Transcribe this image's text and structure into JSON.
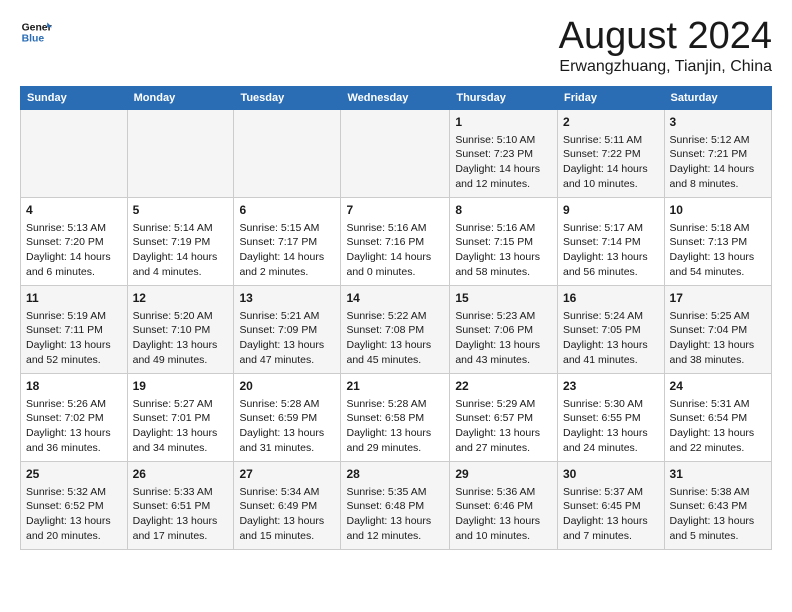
{
  "logo": {
    "line1": "General",
    "line2": "Blue"
  },
  "title": "August 2024",
  "location": "Erwangzhuang, Tianjin, China",
  "headers": [
    "Sunday",
    "Monday",
    "Tuesday",
    "Wednesday",
    "Thursday",
    "Friday",
    "Saturday"
  ],
  "rows": [
    [
      {
        "day": "",
        "sunrise": "",
        "sunset": "",
        "daylight": ""
      },
      {
        "day": "",
        "sunrise": "",
        "sunset": "",
        "daylight": ""
      },
      {
        "day": "",
        "sunrise": "",
        "sunset": "",
        "daylight": ""
      },
      {
        "day": "",
        "sunrise": "",
        "sunset": "",
        "daylight": ""
      },
      {
        "day": "1",
        "sunrise": "Sunrise: 5:10 AM",
        "sunset": "Sunset: 7:23 PM",
        "daylight": "Daylight: 14 hours and 12 minutes."
      },
      {
        "day": "2",
        "sunrise": "Sunrise: 5:11 AM",
        "sunset": "Sunset: 7:22 PM",
        "daylight": "Daylight: 14 hours and 10 minutes."
      },
      {
        "day": "3",
        "sunrise": "Sunrise: 5:12 AM",
        "sunset": "Sunset: 7:21 PM",
        "daylight": "Daylight: 14 hours and 8 minutes."
      }
    ],
    [
      {
        "day": "4",
        "sunrise": "Sunrise: 5:13 AM",
        "sunset": "Sunset: 7:20 PM",
        "daylight": "Daylight: 14 hours and 6 minutes."
      },
      {
        "day": "5",
        "sunrise": "Sunrise: 5:14 AM",
        "sunset": "Sunset: 7:19 PM",
        "daylight": "Daylight: 14 hours and 4 minutes."
      },
      {
        "day": "6",
        "sunrise": "Sunrise: 5:15 AM",
        "sunset": "Sunset: 7:17 PM",
        "daylight": "Daylight: 14 hours and 2 minutes."
      },
      {
        "day": "7",
        "sunrise": "Sunrise: 5:16 AM",
        "sunset": "Sunset: 7:16 PM",
        "daylight": "Daylight: 14 hours and 0 minutes."
      },
      {
        "day": "8",
        "sunrise": "Sunrise: 5:16 AM",
        "sunset": "Sunset: 7:15 PM",
        "daylight": "Daylight: 13 hours and 58 minutes."
      },
      {
        "day": "9",
        "sunrise": "Sunrise: 5:17 AM",
        "sunset": "Sunset: 7:14 PM",
        "daylight": "Daylight: 13 hours and 56 minutes."
      },
      {
        "day": "10",
        "sunrise": "Sunrise: 5:18 AM",
        "sunset": "Sunset: 7:13 PM",
        "daylight": "Daylight: 13 hours and 54 minutes."
      }
    ],
    [
      {
        "day": "11",
        "sunrise": "Sunrise: 5:19 AM",
        "sunset": "Sunset: 7:11 PM",
        "daylight": "Daylight: 13 hours and 52 minutes."
      },
      {
        "day": "12",
        "sunrise": "Sunrise: 5:20 AM",
        "sunset": "Sunset: 7:10 PM",
        "daylight": "Daylight: 13 hours and 49 minutes."
      },
      {
        "day": "13",
        "sunrise": "Sunrise: 5:21 AM",
        "sunset": "Sunset: 7:09 PM",
        "daylight": "Daylight: 13 hours and 47 minutes."
      },
      {
        "day": "14",
        "sunrise": "Sunrise: 5:22 AM",
        "sunset": "Sunset: 7:08 PM",
        "daylight": "Daylight: 13 hours and 45 minutes."
      },
      {
        "day": "15",
        "sunrise": "Sunrise: 5:23 AM",
        "sunset": "Sunset: 7:06 PM",
        "daylight": "Daylight: 13 hours and 43 minutes."
      },
      {
        "day": "16",
        "sunrise": "Sunrise: 5:24 AM",
        "sunset": "Sunset: 7:05 PM",
        "daylight": "Daylight: 13 hours and 41 minutes."
      },
      {
        "day": "17",
        "sunrise": "Sunrise: 5:25 AM",
        "sunset": "Sunset: 7:04 PM",
        "daylight": "Daylight: 13 hours and 38 minutes."
      }
    ],
    [
      {
        "day": "18",
        "sunrise": "Sunrise: 5:26 AM",
        "sunset": "Sunset: 7:02 PM",
        "daylight": "Daylight: 13 hours and 36 minutes."
      },
      {
        "day": "19",
        "sunrise": "Sunrise: 5:27 AM",
        "sunset": "Sunset: 7:01 PM",
        "daylight": "Daylight: 13 hours and 34 minutes."
      },
      {
        "day": "20",
        "sunrise": "Sunrise: 5:28 AM",
        "sunset": "Sunset: 6:59 PM",
        "daylight": "Daylight: 13 hours and 31 minutes."
      },
      {
        "day": "21",
        "sunrise": "Sunrise: 5:28 AM",
        "sunset": "Sunset: 6:58 PM",
        "daylight": "Daylight: 13 hours and 29 minutes."
      },
      {
        "day": "22",
        "sunrise": "Sunrise: 5:29 AM",
        "sunset": "Sunset: 6:57 PM",
        "daylight": "Daylight: 13 hours and 27 minutes."
      },
      {
        "day": "23",
        "sunrise": "Sunrise: 5:30 AM",
        "sunset": "Sunset: 6:55 PM",
        "daylight": "Daylight: 13 hours and 24 minutes."
      },
      {
        "day": "24",
        "sunrise": "Sunrise: 5:31 AM",
        "sunset": "Sunset: 6:54 PM",
        "daylight": "Daylight: 13 hours and 22 minutes."
      }
    ],
    [
      {
        "day": "25",
        "sunrise": "Sunrise: 5:32 AM",
        "sunset": "Sunset: 6:52 PM",
        "daylight": "Daylight: 13 hours and 20 minutes."
      },
      {
        "day": "26",
        "sunrise": "Sunrise: 5:33 AM",
        "sunset": "Sunset: 6:51 PM",
        "daylight": "Daylight: 13 hours and 17 minutes."
      },
      {
        "day": "27",
        "sunrise": "Sunrise: 5:34 AM",
        "sunset": "Sunset: 6:49 PM",
        "daylight": "Daylight: 13 hours and 15 minutes."
      },
      {
        "day": "28",
        "sunrise": "Sunrise: 5:35 AM",
        "sunset": "Sunset: 6:48 PM",
        "daylight": "Daylight: 13 hours and 12 minutes."
      },
      {
        "day": "29",
        "sunrise": "Sunrise: 5:36 AM",
        "sunset": "Sunset: 6:46 PM",
        "daylight": "Daylight: 13 hours and 10 minutes."
      },
      {
        "day": "30",
        "sunrise": "Sunrise: 5:37 AM",
        "sunset": "Sunset: 6:45 PM",
        "daylight": "Daylight: 13 hours and 7 minutes."
      },
      {
        "day": "31",
        "sunrise": "Sunrise: 5:38 AM",
        "sunset": "Sunset: 6:43 PM",
        "daylight": "Daylight: 13 hours and 5 minutes."
      }
    ]
  ]
}
